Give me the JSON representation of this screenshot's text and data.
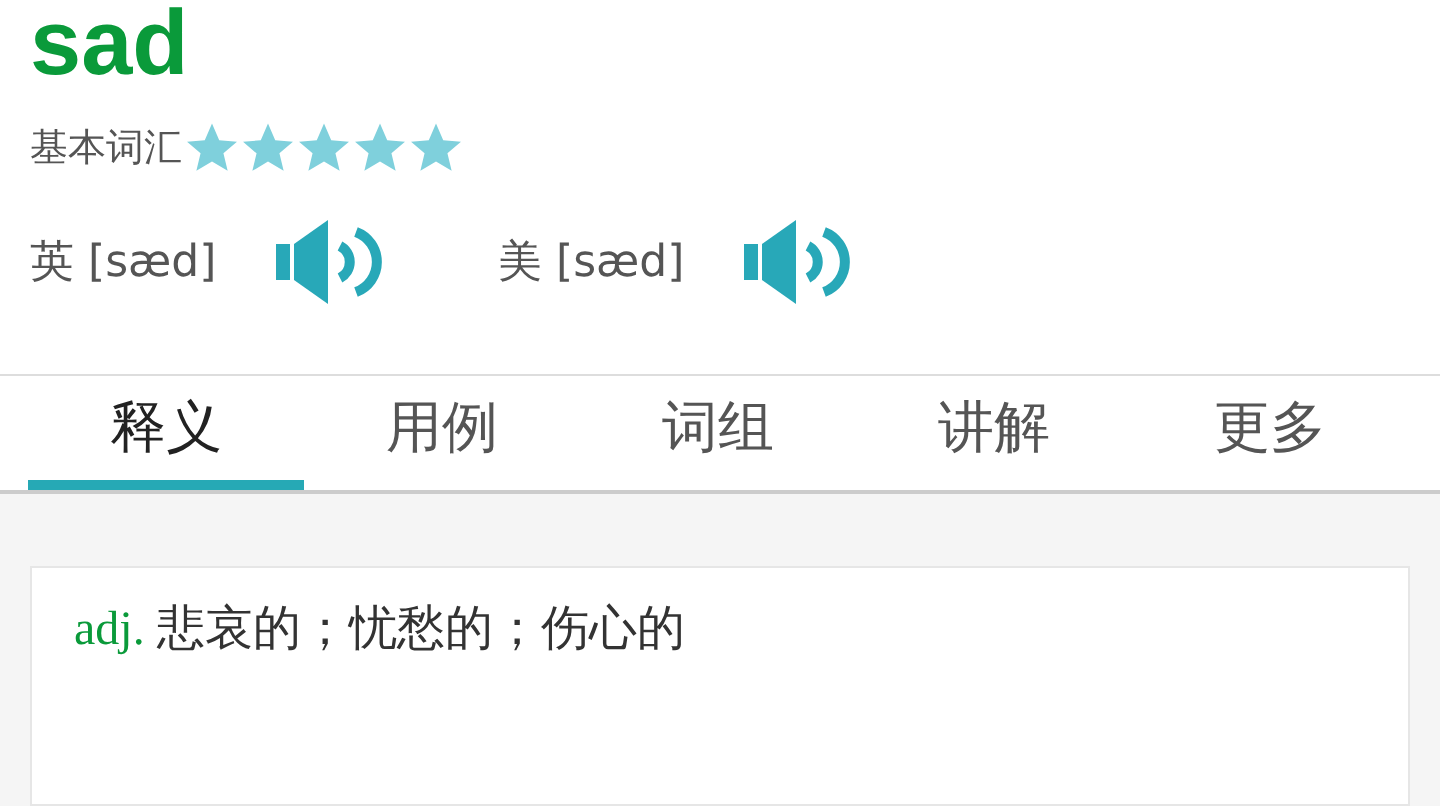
{
  "word": "sad",
  "level": {
    "label": "基本词汇",
    "stars": 5
  },
  "pronunciations": [
    {
      "label": "英 [sæd]"
    },
    {
      "label": "美 [sæd]"
    }
  ],
  "tabs": [
    {
      "label": "释义",
      "selected": true
    },
    {
      "label": "用例",
      "selected": false
    },
    {
      "label": "词组",
      "selected": false
    },
    {
      "label": "讲解",
      "selected": false
    },
    {
      "label": "更多",
      "selected": false
    }
  ],
  "definitions": [
    {
      "pos": "adj.",
      "meaning": "悲哀的；忧愁的；伤心的"
    }
  ]
}
